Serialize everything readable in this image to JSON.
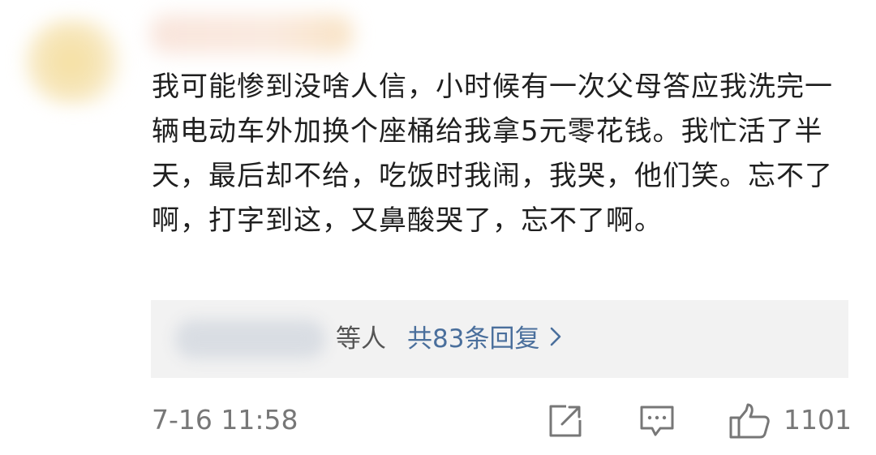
{
  "comment": {
    "text": "我可能惨到没啥人信，小时候有一次父母答应我洗完一辆电动车外加换个座桶给我拿5元零花钱。我忙活了半天，最后却不给，吃饭时我闹，我哭，他们笑。忘不了啊，打字到这，又鼻酸哭了，忘不了啊。"
  },
  "replies": {
    "etc_label": "等人",
    "link_label": "共83条回复",
    "chevron_icon": "chevron-right-icon"
  },
  "footer": {
    "timestamp": "7-16 11:58",
    "share_icon": "share-icon",
    "comment_icon": "comment-icon",
    "like_icon": "thumbs-up-icon",
    "like_count": "1101"
  },
  "colors": {
    "link": "#4a6f9c",
    "muted": "#777777",
    "reply_bg": "#f2f2f2"
  }
}
